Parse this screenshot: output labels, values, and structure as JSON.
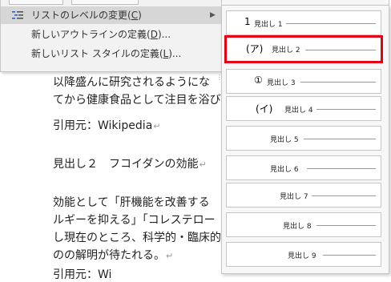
{
  "menu": {
    "items": [
      {
        "label": "リストのレベルの変更(",
        "key": "C",
        "suffix": ")",
        "has_submenu": true
      },
      {
        "label": "新しいアウトラインの定義(",
        "key": "D",
        "suffix": ")..."
      },
      {
        "label": "新しいリスト スタイルの定義(",
        "key": "L",
        "suffix": ")..."
      }
    ],
    "submenu_arrow": "▶",
    "icon": "list-indent-icon"
  },
  "gallery": {
    "levels": [
      {
        "number": "1",
        "label": "見出し 1"
      },
      {
        "number": "(ア)",
        "label": "見出し 2",
        "selected": true
      },
      {
        "number": "①",
        "label": "見出し 3"
      },
      {
        "number": "(イ)",
        "label": "見出し 4"
      },
      {
        "number": "",
        "label": "見出し 5"
      },
      {
        "number": "",
        "label": "見出し 6"
      },
      {
        "number": "",
        "label": "見出し 7"
      },
      {
        "number": "",
        "label": "見出し 8"
      },
      {
        "number": "",
        "label": "見出し 9"
      }
    ],
    "selected_color": "#e60012"
  },
  "document": {
    "lines": [
      "以降盛んに研究されるようにな",
      "てから健康食品として注目を浴び",
      "引用元：Wikipedia",
      "見出し２　フコイダンの効能",
      "効能として「肝機能を改善する",
      "ルギーを抑える」「コレステロー",
      "し現在のところ、科学的・臨床的",
      "のの解明が待たれる。",
      "引用元：Wi"
    ],
    "paragraph_mark": "↵"
  }
}
